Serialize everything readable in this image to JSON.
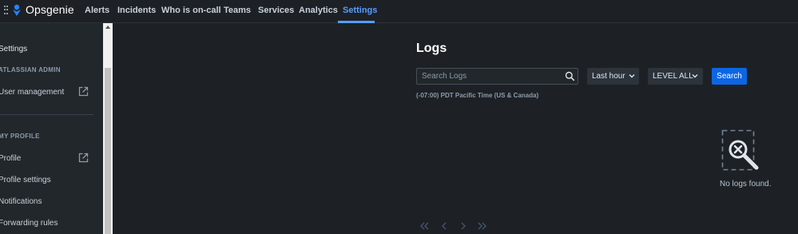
{
  "app": {
    "name": "Opsgenie"
  },
  "nav": {
    "items": [
      "Alerts",
      "Incidents",
      "Who is on-call",
      "Teams",
      "Services",
      "Analytics",
      "Settings"
    ],
    "active": "Settings"
  },
  "sidebar": {
    "title": "Settings",
    "sections": [
      {
        "heading": "ATLASSIAN ADMIN",
        "items": [
          {
            "label": "User management",
            "external": true
          }
        ]
      },
      {
        "heading": "MY PROFILE",
        "items": [
          {
            "label": "Profile",
            "external": true
          },
          {
            "label": "Profile settings",
            "external": false
          },
          {
            "label": "Notifications",
            "external": false
          },
          {
            "label": "Forwarding rules",
            "external": false
          }
        ]
      }
    ]
  },
  "main": {
    "title": "Logs",
    "search": {
      "placeholder": "Search Logs",
      "value": ""
    },
    "time_filter": "Last hour",
    "level_filter": "LEVEL ALL",
    "search_button": "Search",
    "timezone": "(-07:00) PDT Pacific Time (US & Canada)",
    "empty_message": "No logs found."
  },
  "pagination": {
    "icons": [
      "double-chevron-left-icon",
      "chevron-left-icon",
      "chevron-right-icon",
      "double-chevron-right-icon"
    ]
  },
  "colors": {
    "background": "#1d2125",
    "sidebar": "#22272b",
    "accent": "#579dff",
    "primary_button": "#0c66e4"
  }
}
